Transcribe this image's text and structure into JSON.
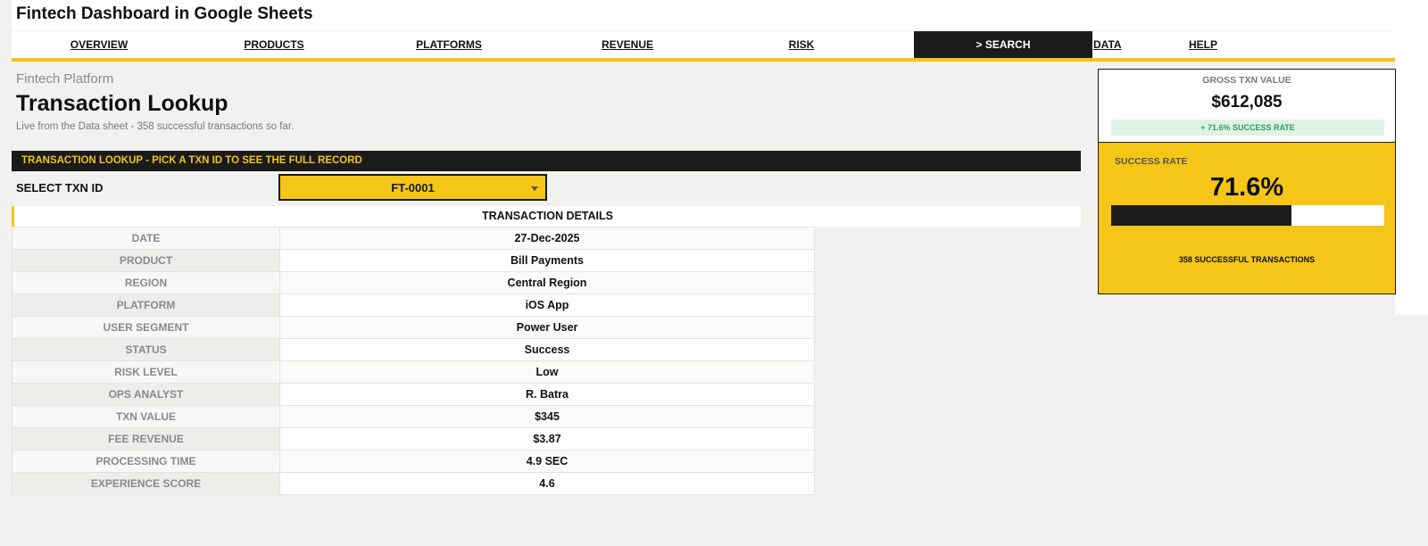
{
  "header": {
    "title": "Fintech Dashboard in Google Sheets"
  },
  "nav": {
    "items": [
      {
        "label": "OVERVIEW"
      },
      {
        "label": "PRODUCTS"
      },
      {
        "label": "PLATFORMS"
      },
      {
        "label": "REVENUE"
      },
      {
        "label": "RISK"
      },
      {
        "label": "> SEARCH",
        "active": true
      },
      {
        "label": "DATA"
      },
      {
        "label": "HELP"
      }
    ]
  },
  "page": {
    "eyebrow": "Fintech Platform",
    "title": "Transaction Lookup",
    "subtitle": "Live from the Data sheet  -  358 successful transactions so far."
  },
  "lookup": {
    "header": "TRANSACTION LOOKUP  -  PICK A TXN ID TO SEE THE FULL RECORD",
    "select_label": "SELECT TXN ID",
    "selected_txn": "FT-0001",
    "details_title": "TRANSACTION DETAILS",
    "rows": [
      {
        "label": "DATE",
        "value": "27-Dec-2025"
      },
      {
        "label": "PRODUCT",
        "value": "Bill Payments"
      },
      {
        "label": "REGION",
        "value": "Central Region"
      },
      {
        "label": "PLATFORM",
        "value": "iOS App"
      },
      {
        "label": "USER SEGMENT",
        "value": "Power User"
      },
      {
        "label": "STATUS",
        "value": "Success"
      },
      {
        "label": "RISK LEVEL",
        "value": "Low"
      },
      {
        "label": "OPS ANALYST",
        "value": "R. Batra"
      },
      {
        "label": "TXN VALUE",
        "value": "$345"
      },
      {
        "label": "FEE REVENUE",
        "value": "$3.87"
      },
      {
        "label": "PROCESSING TIME",
        "value": "4.9 SEC"
      },
      {
        "label": "EXPERIENCE SCORE",
        "value": "4.6"
      }
    ]
  },
  "kpi": {
    "gross_label": "GROSS TXN VALUE",
    "gross_value": "$612,085",
    "gross_chip": "+ 71.6% SUCCESS RATE",
    "rate_label": "SUCCESS RATE",
    "rate_value": "71.6%",
    "rate_fraction": 0.66,
    "rate_footer": "358 SUCCESSFUL TRANSACTIONS"
  },
  "colors": {
    "accent": "#f0c419",
    "dark": "#1b1b1b",
    "positive": "#2e9c57"
  }
}
